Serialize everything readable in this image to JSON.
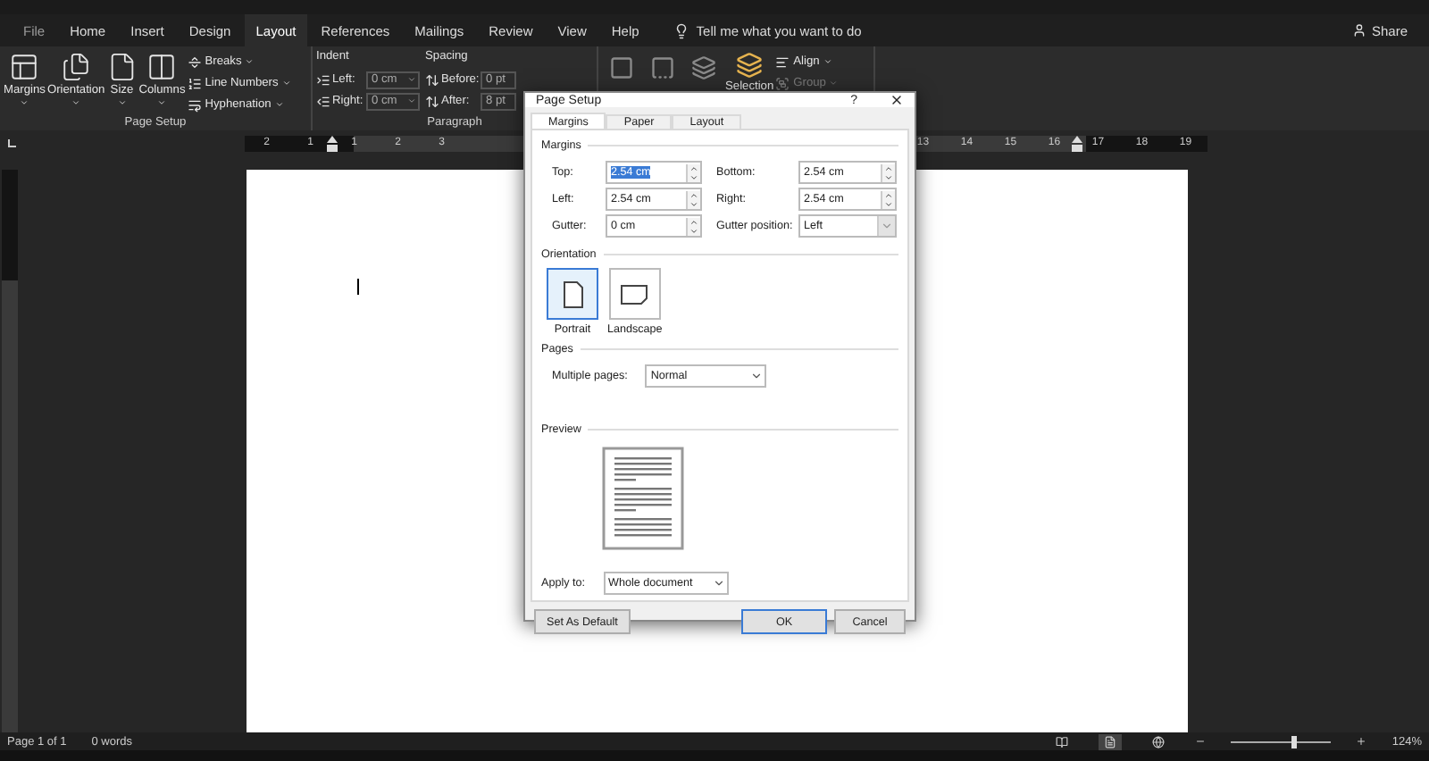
{
  "ribbon_tabs": [
    {
      "label": "File",
      "selected": false
    },
    {
      "label": "Home",
      "selected": false
    },
    {
      "label": "Insert",
      "selected": false
    },
    {
      "label": "Design",
      "selected": false
    },
    {
      "label": "Layout",
      "selected": true
    },
    {
      "label": "References",
      "selected": false
    },
    {
      "label": "Mailings",
      "selected": false
    },
    {
      "label": "Review",
      "selected": false
    },
    {
      "label": "View",
      "selected": false
    },
    {
      "label": "Help",
      "selected": false
    }
  ],
  "tell_me": "Tell me what you want to do",
  "share": "Share",
  "ribbon": {
    "page_setup": {
      "title": "Page Setup",
      "large_buttons": [
        {
          "label": "Margins"
        },
        {
          "label": "Orientation"
        },
        {
          "label": "Size"
        },
        {
          "label": "Columns"
        }
      ],
      "small_buttons": [
        {
          "label": "Breaks"
        },
        {
          "label": "Line Numbers"
        },
        {
          "label": "Hyphenation"
        }
      ]
    },
    "paragraph": {
      "title": "Paragraph",
      "indent": {
        "heading": "Indent",
        "fields": [
          {
            "label": "Left:",
            "value": "0 cm"
          },
          {
            "label": "Right:",
            "value": "0 cm"
          }
        ]
      },
      "spacing": {
        "heading": "Spacing",
        "fields": [
          {
            "label": "Before:",
            "value": "0 pt"
          },
          {
            "label": "After:",
            "value": "8 pt"
          }
        ]
      }
    },
    "arrange": {
      "selection_label": "Selection",
      "small_buttons": [
        {
          "label": "Align",
          "disabled": false
        },
        {
          "label": "Group",
          "disabled": true
        }
      ]
    }
  },
  "ruler": {
    "left": [
      {
        "kind": "number",
        "label": "2"
      },
      {
        "kind": "number",
        "label": "1"
      },
      {
        "kind": "marker"
      },
      {
        "kind": "number",
        "label": "1"
      },
      {
        "kind": "number",
        "label": "2"
      },
      {
        "kind": "number",
        "label": "3"
      }
    ],
    "right": [
      {
        "kind": "number",
        "label": "13"
      },
      {
        "kind": "number",
        "label": "14"
      },
      {
        "kind": "number",
        "label": "15"
      },
      {
        "kind": "number",
        "label": "16"
      },
      {
        "kind": "marker"
      },
      {
        "kind": "number",
        "label": "17"
      },
      {
        "kind": "number",
        "label": "18"
      },
      {
        "kind": "number",
        "label": "19"
      }
    ]
  },
  "dialog": {
    "title": "Page Setup",
    "help": "?",
    "tabs": [
      {
        "label": "Margins",
        "selected": true
      },
      {
        "label": "Paper",
        "selected": false
      },
      {
        "label": "Layout",
        "selected": false
      }
    ],
    "margins": {
      "heading": "Margins",
      "fields": [
        {
          "label": "Top:",
          "value": "2.54 cm",
          "kind": "spinner",
          "highlighted": true
        },
        {
          "label": "Bottom:",
          "value": "2.54 cm",
          "kind": "spinner",
          "highlighted": false
        },
        {
          "label": "Left:",
          "value": "2.54 cm",
          "kind": "spinner",
          "highlighted": false
        },
        {
          "label": "Right:",
          "value": "2.54 cm",
          "kind": "spinner",
          "highlighted": false
        },
        {
          "label": "Gutter:",
          "value": "0 cm",
          "kind": "spinner",
          "highlighted": false
        },
        {
          "label": "Gutter position:",
          "value": "Left",
          "kind": "dropdown",
          "disabled": true
        }
      ]
    },
    "orientation": {
      "heading": "Orientation",
      "options": [
        {
          "label": "Portrait",
          "selected": true
        },
        {
          "label": "Landscape",
          "selected": false
        }
      ]
    },
    "pages": {
      "heading": "Pages",
      "label": "Multiple pages:",
      "value": "Normal"
    },
    "preview": {
      "heading": "Preview"
    },
    "apply_to": {
      "label": "Apply to:",
      "value": "Whole document"
    },
    "buttons": [
      {
        "label": "Set As Default",
        "default": false
      },
      {
        "label": "OK",
        "default": true
      },
      {
        "label": "Cancel",
        "default": false
      }
    ]
  },
  "status_bar": {
    "page": "Page 1 of 1",
    "words": "0 words",
    "views": [
      {
        "selected": false
      },
      {
        "selected": true
      },
      {
        "selected": false
      }
    ],
    "zoom": {
      "level": 0.62,
      "reading": "124%"
    }
  }
}
